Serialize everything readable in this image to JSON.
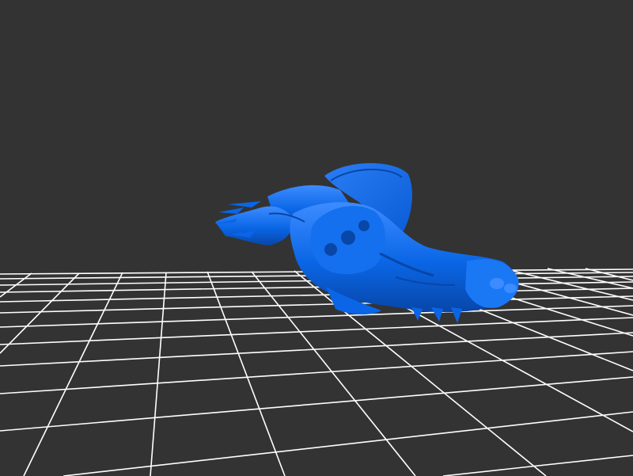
{
  "viewer": {
    "background_color": "#333333",
    "grid_color": "#ffffff",
    "model_color": "#0a66e6",
    "model_highlight_color": "#3d8cff",
    "model_shadow_color": "#0846a8",
    "model_icon": "3d-mesh-model",
    "grid_visible": true
  }
}
